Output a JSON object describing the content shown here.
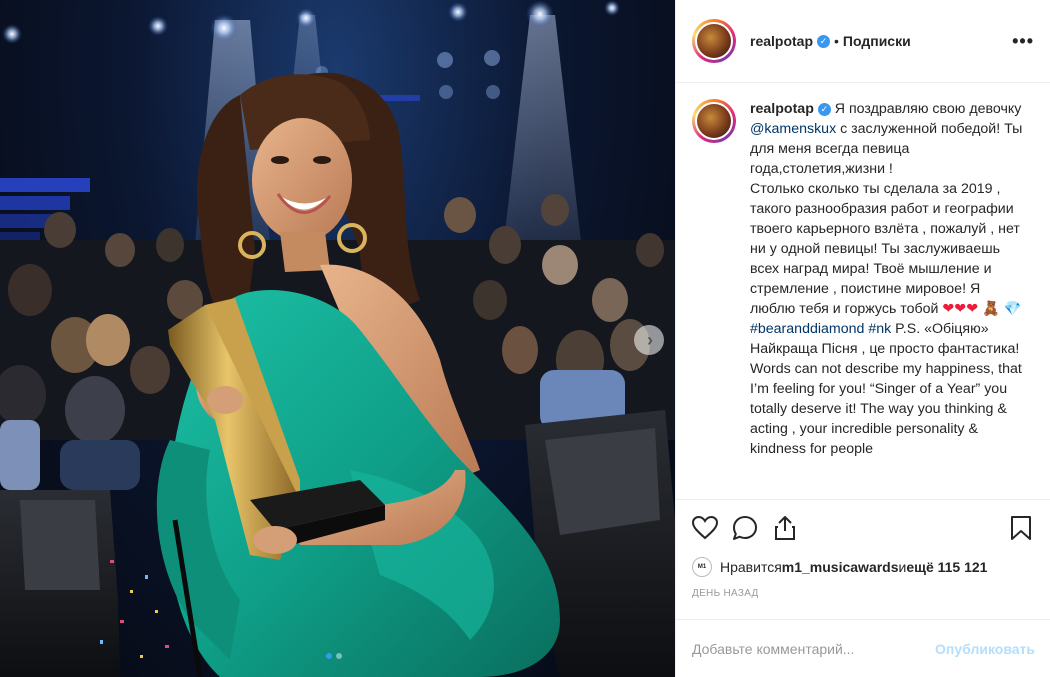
{
  "post": {
    "username": "realpotap",
    "follow_label": "Подписки",
    "more_label": "•••"
  },
  "caption": {
    "username": "realpotap",
    "text_1": " Я поздравляю свою девочку ",
    "mention": "@kamenskux",
    "text_2": " с заслуженной победой! Ты для меня всегда певица года,столетия,жизни !\nСтолько сколько ты сделала за 2019 , такого разнообразия работ и географии твоего карьерного взлёта , пожалуй , нет ни у одной певицы! Ты заслуживаешь всех наград мира! Твоё мышление и стремление , поистине мировое! Я люблю тебя и горжусь тобой ",
    "emoji_hearts": "❤❤❤",
    "emoji_bear": "🧸",
    "emoji_diamond": "💎",
    "hashtag_1": "#bearanddiamond",
    "hashtag_2": "#nk",
    "text_3": " P.S. «Обіцяю» Найкраща Пісня , це просто фантастика!\nWords can not describe my happiness, that I’m feeling for you! “Singer of a Year” you totally deserve it! The way you thinking & acting , your incredible personality & kindness for people"
  },
  "likes": {
    "prefix": "Нравится ",
    "user": "m1_musicawards",
    "middle": " и ",
    "count": "ещё 115 121",
    "avatar_text": "M1"
  },
  "time_label": "День назад",
  "comment": {
    "placeholder": "Добавьте комментарий...",
    "publish_label": "Опубликовать"
  },
  "colors": {
    "accent": "#3897f0",
    "dress": "#14a48e",
    "link": "#003569"
  }
}
